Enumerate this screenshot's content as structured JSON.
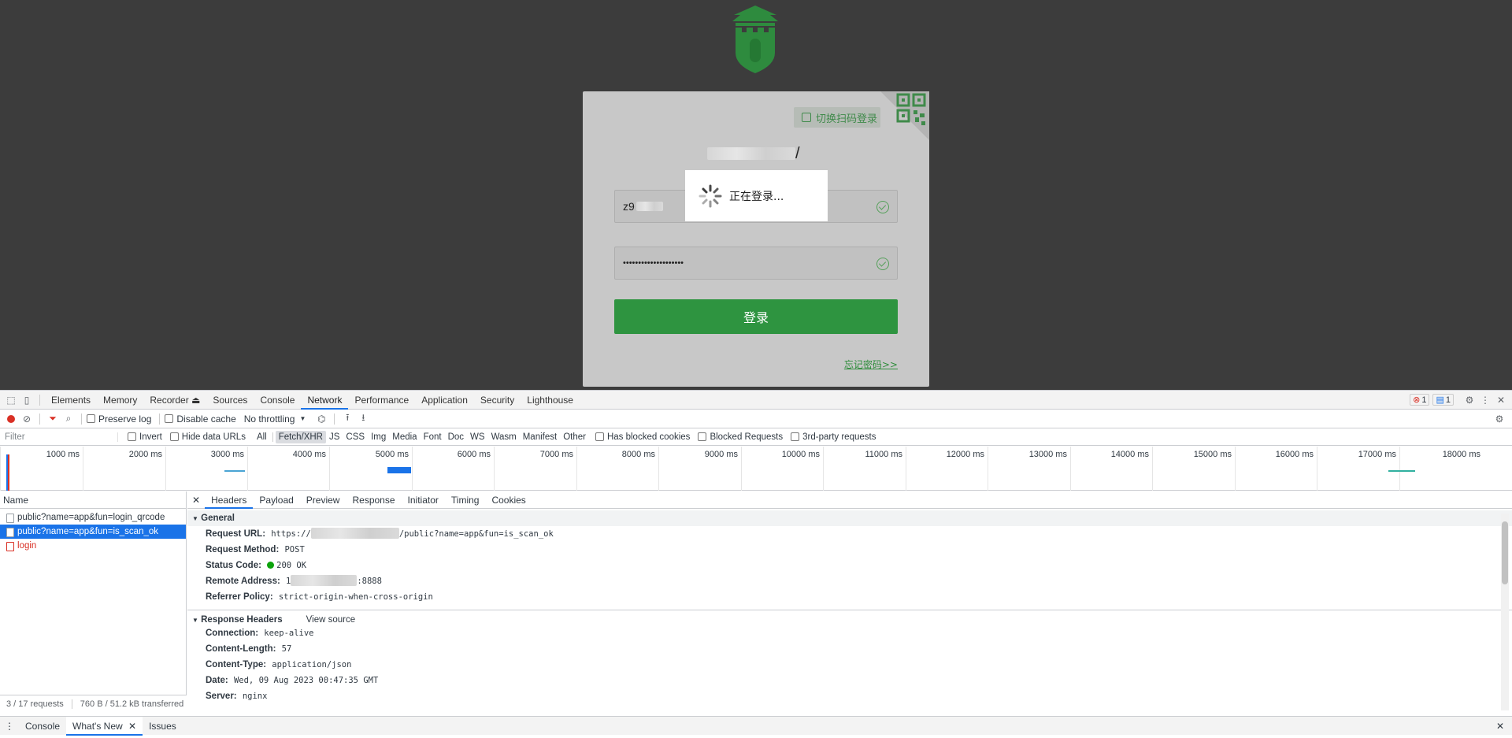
{
  "login": {
    "qr_switch_label": "切换扫码登录",
    "site_title": "/",
    "username_value": "z9",
    "password_value": "••••••••••••••••••••",
    "login_button": "登录",
    "forgot_link": "忘记密码>>",
    "loading_text": "正在登录..."
  },
  "devtools": {
    "tabs": [
      "Elements",
      "Memory",
      "Recorder ⏏",
      "Sources",
      "Console",
      "Network",
      "Performance",
      "Application",
      "Security",
      "Lighthouse"
    ],
    "active_tab": "Network",
    "error_count": "1",
    "message_count": "1",
    "toolbar": {
      "preserve_log": "Preserve log",
      "disable_cache": "Disable cache",
      "throttling": "No throttling"
    },
    "filter": {
      "placeholder": "Filter",
      "invert": "Invert",
      "hide_data_urls": "Hide data URLs",
      "types": [
        "All",
        "Fetch/XHR",
        "JS",
        "CSS",
        "Img",
        "Media",
        "Font",
        "Doc",
        "WS",
        "Wasm",
        "Manifest",
        "Other"
      ],
      "selected_type": "Fetch/XHR",
      "has_blocked_cookies": "Has blocked cookies",
      "blocked_requests": "Blocked Requests",
      "third_party": "3rd-party requests"
    },
    "timeline_ticks": [
      "1000 ms",
      "2000 ms",
      "3000 ms",
      "4000 ms",
      "5000 ms",
      "6000 ms",
      "7000 ms",
      "8000 ms",
      "9000 ms",
      "10000 ms",
      "11000 ms",
      "12000 ms",
      "13000 ms",
      "14000 ms",
      "15000 ms",
      "16000 ms",
      "17000 ms",
      "18000 ms"
    ],
    "requests": {
      "header": "Name",
      "items": [
        "public?name=app&fun=login_qrcode",
        "public?name=app&fun=is_scan_ok",
        "login"
      ],
      "footer_requests": "3 / 17 requests",
      "footer_transferred": "760 B / 51.2 kB transferred"
    },
    "detail_tabs": [
      "Headers",
      "Payload",
      "Preview",
      "Response",
      "Initiator",
      "Timing",
      "Cookies"
    ],
    "general": {
      "title": "General",
      "request_url_label": "Request URL:",
      "request_url_prefix": "https://",
      "request_url_suffix": "/public?name=app&fun=is_scan_ok",
      "request_method_label": "Request Method:",
      "request_method": "POST",
      "status_code_label": "Status Code:",
      "status_code": "200 OK",
      "remote_address_label": "Remote Address:",
      "remote_address_prefix": "1",
      "remote_address_suffix": ":8888",
      "referrer_policy_label": "Referrer Policy:",
      "referrer_policy": "strict-origin-when-cross-origin"
    },
    "response_headers": {
      "title": "Response Headers",
      "view_source": "View source",
      "connection_label": "Connection:",
      "connection": "keep-alive",
      "content_length_label": "Content-Length:",
      "content_length": "57",
      "content_type_label": "Content-Type:",
      "content_type": "application/json",
      "date_label": "Date:",
      "date": "Wed, 09 Aug 2023 00:47:35 GMT",
      "server_label": "Server:",
      "server": "nginx"
    },
    "drawer_tabs": [
      "Console",
      "What's New",
      "Issues"
    ]
  }
}
